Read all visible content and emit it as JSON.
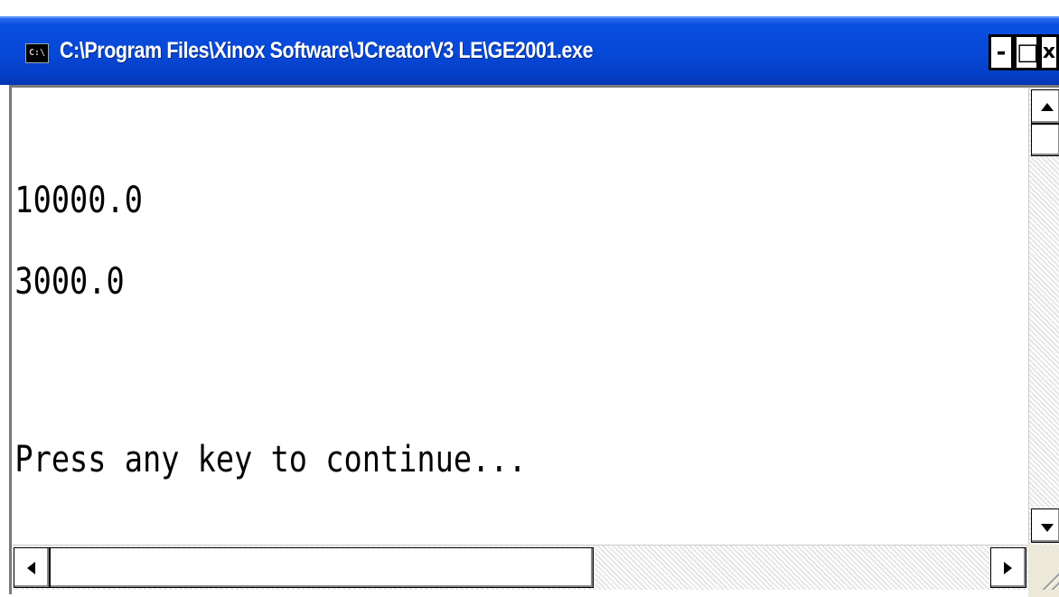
{
  "window": {
    "title": "C:\\Program Files\\Xinox Software\\JCreatorV3 LE\\GE2001.exe",
    "icon_label": "C:\\",
    "controls": {
      "minimize": "-",
      "maximize": "□",
      "close": "x"
    }
  },
  "console": {
    "lines": [
      "10000.0",
      "3000.0",
      "",
      "Press any key to continue..."
    ]
  },
  "icons": {
    "app": "console-app-icon",
    "scroll_up": "triangle-up-icon",
    "scroll_down": "triangle-down-icon",
    "scroll_left": "triangle-left-icon",
    "scroll_right": "triangle-right-icon",
    "resize": "resize-grip-icon"
  },
  "colors": {
    "titlebar": "#0648d8",
    "console_bg": "#ffffff",
    "console_text": "#000000"
  }
}
